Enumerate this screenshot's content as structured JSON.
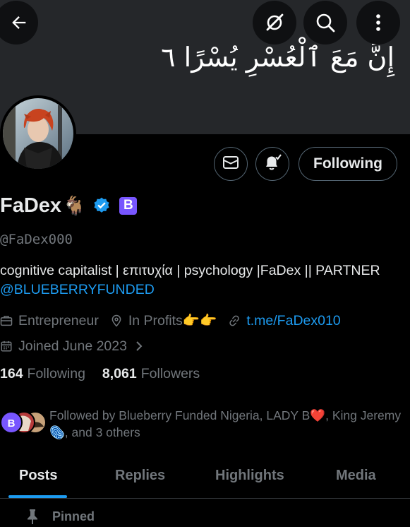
{
  "header": {
    "banner_text": "إِنَّ مَعَ ٱلْعُسْرِ يُسْرًا ٦",
    "back_icon": "arrow-left-icon",
    "grok_icon": "grok-icon",
    "search_icon": "search-icon",
    "more_icon": "more-vertical-icon"
  },
  "profile": {
    "name": "FaDex",
    "name_emoji": "🐐",
    "badge_letter": "B",
    "handle": "@FaDex000",
    "bio_text": "cognitive capitalist | επιτυχία | psychology |FaDex || PARTNER",
    "bio_link": "@BLUEBERRYFUNDED",
    "category": "Entrepreneur",
    "location": "In Profits👉👉",
    "website": "t.me/FaDex010",
    "joined": "Joined June 2023",
    "following_count": "164",
    "following_label": "Following",
    "followers_count": "8,061",
    "followers_label": "Followers",
    "followed_by_text": "Followed by Blueberry Funded Nigeria, LADY B❤️, King Jeremy 🫆, and 3 others"
  },
  "actions": {
    "following_button": "Following",
    "message_icon": "envelope-icon",
    "notify_icon": "bell-check-icon"
  },
  "tabs": [
    "Posts",
    "Replies",
    "Highlights",
    "Media"
  ],
  "active_tab": "Posts",
  "pinned_label": "Pinned",
  "colors": {
    "accent": "#1d9bf0",
    "muted": "#71767b",
    "badge_purple": "#7856ff",
    "verified": "#1d9bf0"
  }
}
